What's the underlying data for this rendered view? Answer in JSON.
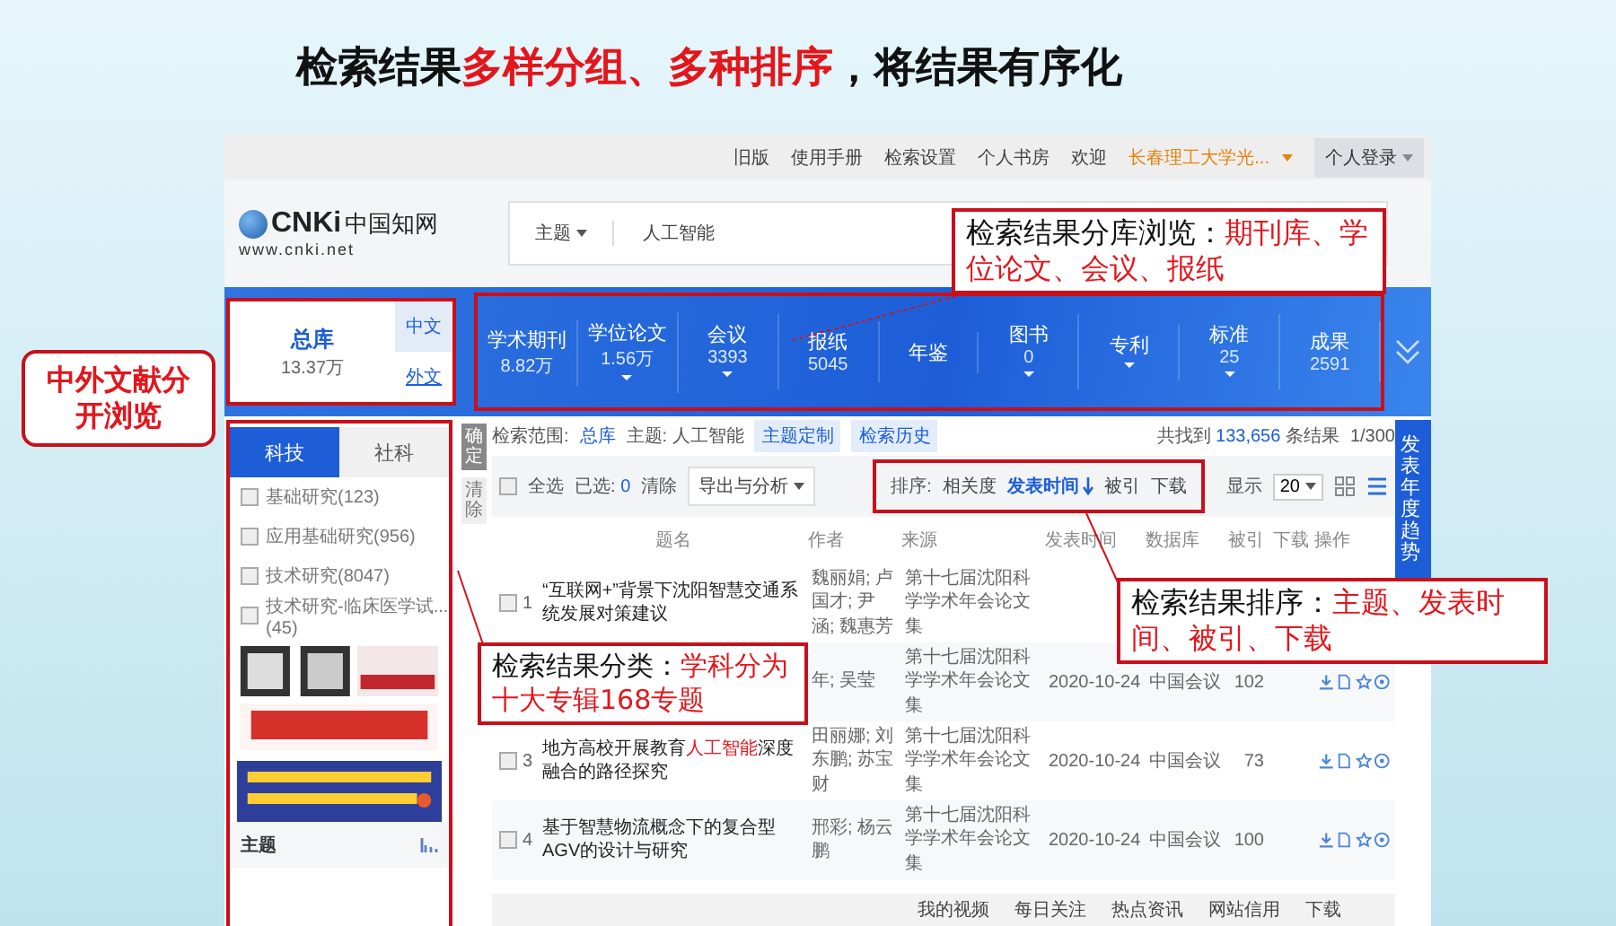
{
  "slide_title": [
    {
      "text": "检索结果",
      "highlight": false
    },
    {
      "text": "多样分组、多种排序",
      "highlight": true
    },
    {
      "text": "，将结果有序化",
      "highlight": false
    }
  ],
  "top_bar": {
    "links": [
      "旧版",
      "使用手册",
      "检索设置",
      "个人书房"
    ],
    "welcome": "欢迎",
    "institution": "长春理工大学光...",
    "login": "个人登录"
  },
  "logo": {
    "mark": "CNKi",
    "name": "中国知网",
    "url": "www.cnki.net"
  },
  "search": {
    "field": "主题",
    "value": "人工智能"
  },
  "total": {
    "label": "总库",
    "count": "13.37万",
    "selected": true
  },
  "languages": [
    {
      "label": "中文",
      "selected": true
    },
    {
      "label": "外文",
      "selected": false
    }
  ],
  "databases": [
    {
      "label": "学术期刊",
      "count": "8.82万",
      "menu": false
    },
    {
      "label": "学位论文",
      "count": "1.56万",
      "menu": true
    },
    {
      "label": "会议",
      "count": "3393",
      "menu": true
    },
    {
      "label": "报纸",
      "count": "5045",
      "menu": false
    },
    {
      "label": "年鉴",
      "menu": false
    },
    {
      "label": "图书",
      "count": "0",
      "menu": true
    },
    {
      "label": "专利",
      "menu": true
    },
    {
      "label": "标准",
      "count": "25",
      "menu": true
    },
    {
      "label": "成果",
      "count": "2591",
      "menu": false
    }
  ],
  "sidebar": {
    "tabs": [
      {
        "label": "科技",
        "selected": true
      },
      {
        "label": "社科",
        "selected": false
      }
    ],
    "items": [
      {
        "label": "基础研究(123)",
        "checked": false
      },
      {
        "label": "应用基础研究(956)",
        "checked": false
      },
      {
        "label": "技术研究(8047)",
        "checked": false
      },
      {
        "label": "技术研究-临床医学试...(45)",
        "checked": false
      }
    ],
    "section": "主题"
  },
  "side_buttons": [
    "确定",
    "清除"
  ],
  "scope": {
    "label": "检索范围:",
    "value": "总库",
    "query": "主题: 人工智能",
    "buttons": [
      "主题定制",
      "检索历史"
    ]
  },
  "result_count": {
    "prefix": "共找到",
    "count": "133,656",
    "suffix": "条结果",
    "page": "1/300"
  },
  "toolbar": {
    "select_all": "全选",
    "select_all_checked": false,
    "selected": "已选:",
    "selected_count": "0",
    "clear": "清除",
    "export": "导出与分析"
  },
  "sort": {
    "label": "排序:",
    "options": [
      {
        "label": "相关度",
        "selected": false
      },
      {
        "label": "发表时间",
        "selected": true
      },
      {
        "label": "被引",
        "selected": false
      },
      {
        "label": "下载",
        "selected": false
      }
    ]
  },
  "page_size": {
    "label": "显示",
    "value": "20"
  },
  "columns": [
    "题名",
    "作者",
    "来源",
    "发表时间",
    "数据库",
    "被引",
    "下载",
    "操作"
  ],
  "rows": [
    {
      "num": "1",
      "checked": false,
      "title": [
        {
          "text": "“互联网+”背景下沈阳智慧交通系统发展对策建议",
          "highlight": false
        }
      ],
      "authors": "魏丽娟; 卢国才; 尹涵; 魏惠芳",
      "source": "第十七届沈阳科学学术年会论文集"
    },
    {
      "authors": "年; 吴莹",
      "source": "第十七届沈阳科学学术年会论文集",
      "date": "2020-10-24",
      "database": "中国会议",
      "cited": "102"
    },
    {
      "num": "3",
      "checked": false,
      "title": [
        {
          "text": "地方高校开展教育",
          "highlight": false
        },
        {
          "text": "人工智能",
          "highlight": true
        },
        {
          "text": "深度融合的路径探究",
          "highlight": false
        }
      ],
      "authors": "田丽娜; 刘东鹏; 苏宝财",
      "source": "第十七届沈阳科学学术年会论文集",
      "date": "2020-10-24",
      "database": "中国会议",
      "cited": "73"
    },
    {
      "num": "4",
      "checked": false,
      "title": [
        {
          "text": "基于智慧物流概念下的复合型AGV的设计与研究",
          "highlight": false
        }
      ],
      "authors": "邢彩; 杨云鹏",
      "source": "第十七届沈阳科学学术年会论文集",
      "date": "2020-10-24",
      "database": "中国会议",
      "cited": "100"
    }
  ],
  "trend_tab": "发表年度趋势",
  "bottom_bar": [
    "我的视频",
    "每日关注",
    "热点资讯",
    "网站信用",
    "下载"
  ],
  "callouts": [
    {
      "parts": [
        {
          "text": "检索结果分库浏览：",
          "highlight": false
        },
        {
          "text": "期刊库、学位论文、会议、报纸",
          "highlight": true
        }
      ]
    },
    {
      "parts": [
        {
          "text": "中外文献分开浏览",
          "highlight": true
        }
      ]
    },
    {
      "parts": [
        {
          "text": "检索结果排序：",
          "highlight": false
        },
        {
          "text": "主题、发表时间、被引、下载",
          "highlight": true
        }
      ]
    },
    {
      "parts": [
        {
          "text": "检索结果分类：",
          "highlight": false
        },
        {
          "text": "学科分为十大专辑168专题",
          "highlight": true
        }
      ]
    }
  ]
}
